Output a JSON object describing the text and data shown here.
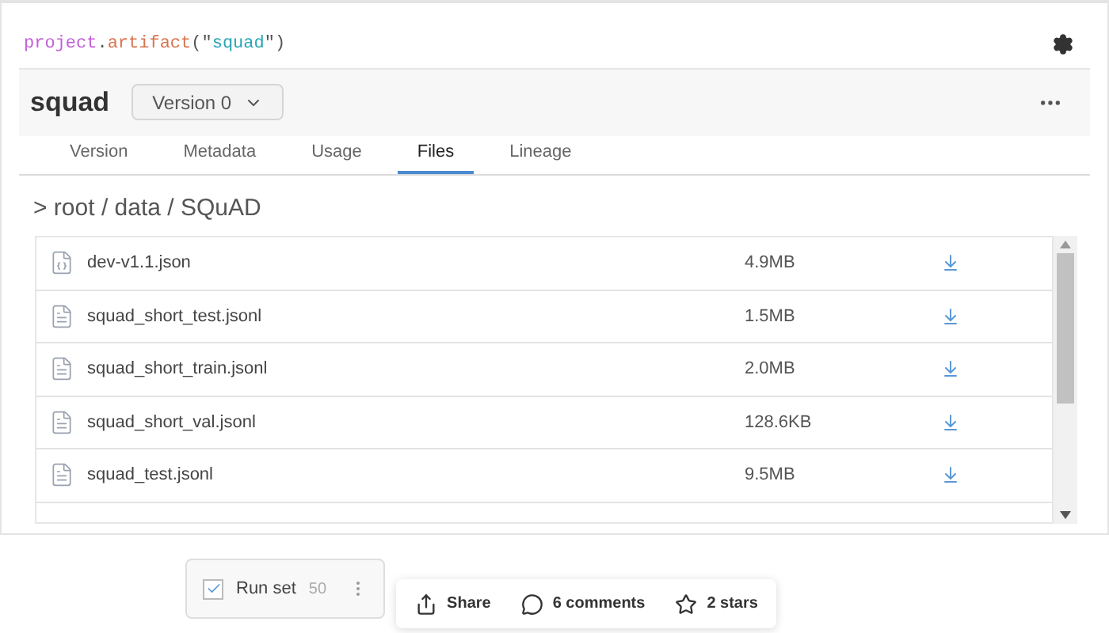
{
  "code_line": {
    "object": "project",
    "dot": ".",
    "method": "artifact",
    "open": "(\"",
    "argument": "squad",
    "close": "\")"
  },
  "artifact": {
    "name": "squad",
    "version_dropdown": "Version 0"
  },
  "tabs": [
    {
      "label": "Version",
      "selected": false
    },
    {
      "label": "Metadata",
      "selected": false
    },
    {
      "label": "Usage",
      "selected": false
    },
    {
      "label": "Files",
      "selected": true
    },
    {
      "label": "Lineage",
      "selected": false
    }
  ],
  "breadcrumb": "> root / data / SQuAD",
  "files": [
    {
      "name": "dev-v1.1.json",
      "kind": "json",
      "size": "4.9MB"
    },
    {
      "name": "squad_short_test.jsonl",
      "kind": "text",
      "size": "1.5MB"
    },
    {
      "name": "squad_short_train.jsonl",
      "kind": "text",
      "size": "2.0MB"
    },
    {
      "name": "squad_short_val.jsonl",
      "kind": "text",
      "size": "128.6KB"
    },
    {
      "name": "squad_test.jsonl",
      "kind": "text",
      "size": "9.5MB"
    }
  ],
  "run_set": {
    "label": "Run set",
    "count": "50",
    "checked": true
  },
  "actions": [
    {
      "kind": "share",
      "label": "Share"
    },
    {
      "kind": "comments",
      "label": "6 comments"
    },
    {
      "kind": "stars",
      "label": "2 stars"
    }
  ]
}
